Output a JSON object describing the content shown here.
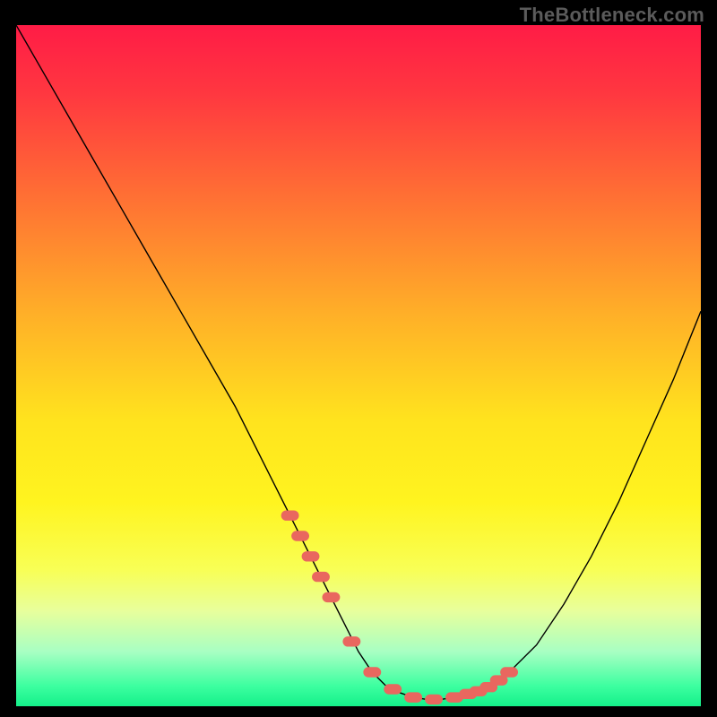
{
  "attribution": "TheBottleneck.com",
  "colors": {
    "page_bg": "#000000",
    "attribution_text": "#5b5b5b",
    "curve_stroke": "#000000",
    "marker_fill": "#e9675f",
    "gradient_stops": [
      {
        "offset": 0.0,
        "color": "#ff1c46"
      },
      {
        "offset": 0.1,
        "color": "#ff3740"
      },
      {
        "offset": 0.25,
        "color": "#ff6f34"
      },
      {
        "offset": 0.42,
        "color": "#ffae28"
      },
      {
        "offset": 0.58,
        "color": "#ffe31e"
      },
      {
        "offset": 0.7,
        "color": "#fff41f"
      },
      {
        "offset": 0.8,
        "color": "#f8ff56"
      },
      {
        "offset": 0.86,
        "color": "#e8ff9c"
      },
      {
        "offset": 0.92,
        "color": "#a8ffc3"
      },
      {
        "offset": 0.97,
        "color": "#3dffa0"
      },
      {
        "offset": 1.0,
        "color": "#14f08a"
      }
    ]
  },
  "chart_data": {
    "type": "line",
    "title": "",
    "xlabel": "",
    "ylabel": "",
    "xlim": [
      0,
      100
    ],
    "ylim": [
      0,
      100
    ],
    "series": [
      {
        "name": "bottleneck-curve",
        "x": [
          0,
          4,
          8,
          12,
          16,
          20,
          24,
          28,
          32,
          36,
          40,
          44,
          48,
          50,
          52,
          54,
          56,
          58,
          60,
          62,
          64,
          68,
          72,
          76,
          80,
          84,
          88,
          92,
          96,
          100
        ],
        "y": [
          100,
          93,
          86,
          79,
          72,
          65,
          58,
          51,
          44,
          36,
          28,
          20,
          12,
          8,
          5,
          3,
          2,
          1.3,
          1,
          1,
          1.3,
          2.5,
          5,
          9,
          15,
          22,
          30,
          39,
          48,
          58
        ]
      }
    ],
    "markers": {
      "name": "highlight-points",
      "x": [
        40.0,
        41.5,
        43.0,
        44.5,
        46.0,
        49.0,
        52.0,
        55.0,
        58.0,
        61.0,
        64.0,
        66.0,
        67.5,
        69.0,
        70.5,
        72.0
      ],
      "y": [
        28.0,
        25.0,
        22.0,
        19.0,
        16.0,
        9.5,
        5.0,
        2.5,
        1.3,
        1.0,
        1.3,
        1.8,
        2.2,
        2.8,
        3.8,
        5.0
      ]
    }
  }
}
